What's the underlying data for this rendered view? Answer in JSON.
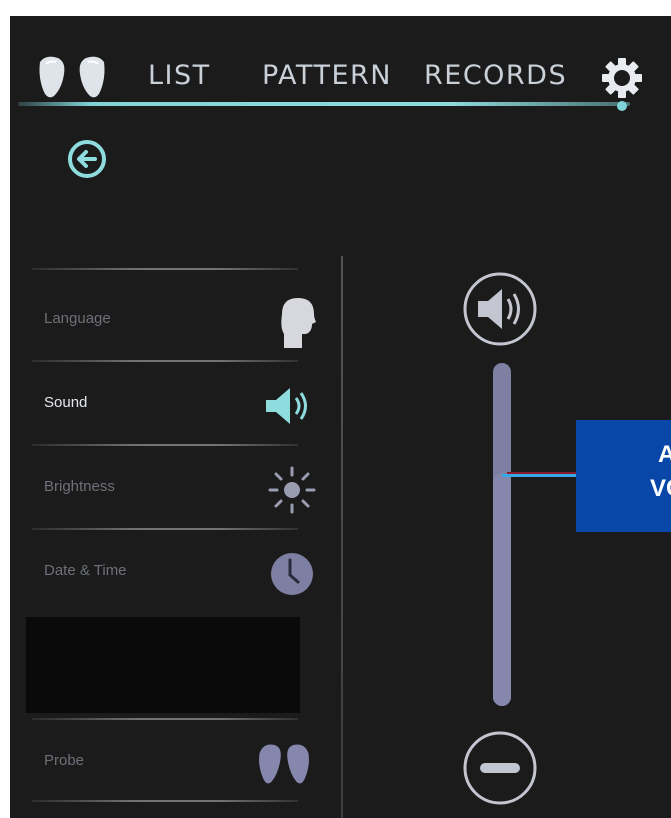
{
  "header": {
    "logo_icon": "probe-earbuds-icon",
    "tabs": [
      {
        "label": "LIST"
      },
      {
        "label": "PATTERN"
      },
      {
        "label": "RECORDS"
      }
    ],
    "settings_icon": "gear-icon",
    "accent_color": "#7fd4d8"
  },
  "back_button": {
    "icon": "arrow-left-circle-icon"
  },
  "settings_menu": {
    "items": [
      {
        "label": "Language",
        "icon": "head-profile-icon",
        "active": false
      },
      {
        "label": "Sound",
        "icon": "speaker-icon",
        "active": true
      },
      {
        "label": "Brightness",
        "icon": "sun-icon",
        "active": false
      },
      {
        "label": "Date & Time",
        "icon": "clock-icon",
        "active": false
      },
      {
        "label": "Probe",
        "icon": "probe-earbuds-icon",
        "active": false
      }
    ]
  },
  "volume": {
    "up_icon": "speaker-loud-icon",
    "down_icon": "minus-circle-icon",
    "level_fraction": 0.68,
    "track_color": "#7d7fa3",
    "marker_color": "#3aa7e6"
  },
  "callout": {
    "line1": "A",
    "line2": "VC",
    "background": "#0847a8"
  }
}
